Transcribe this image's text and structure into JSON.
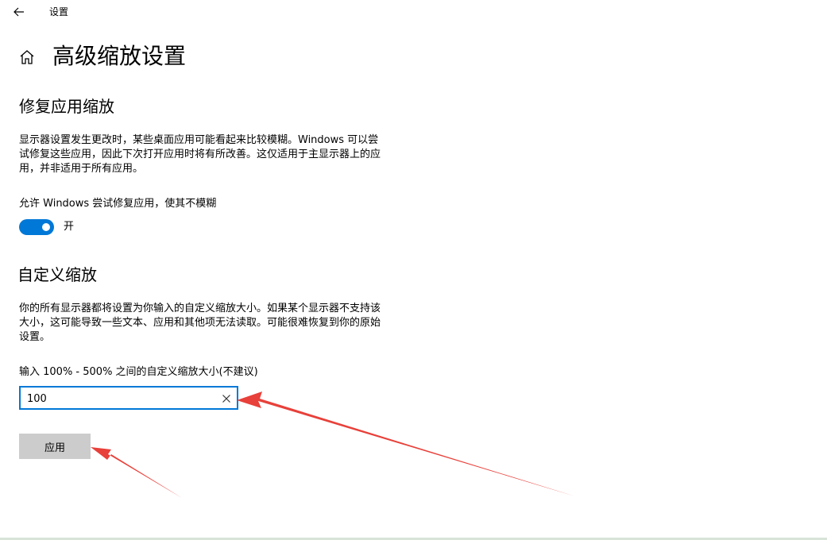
{
  "titlebar": {
    "app_title": "设置",
    "back_icon": "back-arrow-icon"
  },
  "page": {
    "title": "高级缩放设置",
    "home_icon": "home-icon"
  },
  "fix_scaling": {
    "heading": "修复应用缩放",
    "description": "显示器设置发生更改时，某些桌面应用可能看起来比较模糊。Windows 可以尝试修复这些应用，因此下次打开应用时将有所改善。这仅适用于主显示器上的应用，并非适用于所有应用。",
    "toggle_label": "允许 Windows 尝试修复应用，使其不模糊",
    "toggle_state": "开",
    "toggle_on": true
  },
  "custom_scaling": {
    "heading": "自定义缩放",
    "description": "你的所有显示器都将设置为你输入的自定义缩放大小。如果某个显示器不支持该大小，这可能导致一些文本、应用和其他项无法读取。可能很难恢复到你的原始设置。",
    "input_label": "输入 100% - 500% 之间的自定义缩放大小(不建议)",
    "input_value": "100",
    "apply_label": "应用"
  },
  "colors": {
    "accent": "#0078d7",
    "button_bg": "#cccccc",
    "annotation_arrow": "#e8403a"
  }
}
